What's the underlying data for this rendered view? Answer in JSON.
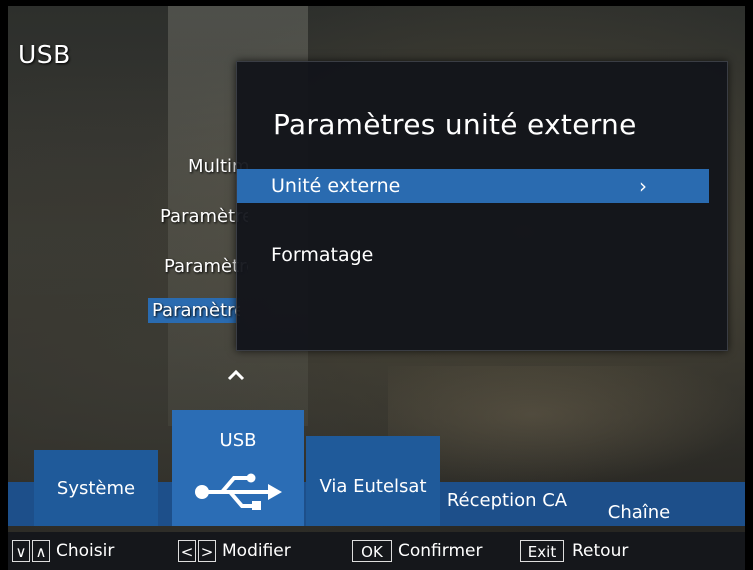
{
  "page_title": "USB",
  "left_menu": [
    {
      "label": "Multimédia",
      "selected": false
    },
    {
      "label": "Paramètres",
      "selected": false
    },
    {
      "label": "Paramètres",
      "selected": false
    },
    {
      "label": "Paramètres",
      "selected": true
    }
  ],
  "popup": {
    "title": "Paramètres unité externe",
    "items": [
      {
        "label": "Unité externe",
        "arrow": "›",
        "selected": true
      },
      {
        "label": "Formatage",
        "arrow": "",
        "selected": false
      }
    ]
  },
  "tabs": [
    {
      "label": "Système"
    },
    {
      "label": "USB",
      "icon": "usb-icon",
      "selected": true
    },
    {
      "label": "Via Eutelsat"
    },
    {
      "label": "Réception CA"
    },
    {
      "label": "Chaîne"
    }
  ],
  "footer": {
    "choose_keys": [
      "∨",
      "∧"
    ],
    "choose_label": "Choisir",
    "modify_keys": [
      "<",
      ">"
    ],
    "modify_label": "Modifier",
    "ok_key": "OK",
    "ok_label": "Confirmer",
    "exit_key": "Exit",
    "exit_label": "Retour"
  },
  "colors": {
    "selection": "#2a6bb0",
    "tab_bar": "#1d4f8a",
    "popup_bg": "#12141a"
  }
}
